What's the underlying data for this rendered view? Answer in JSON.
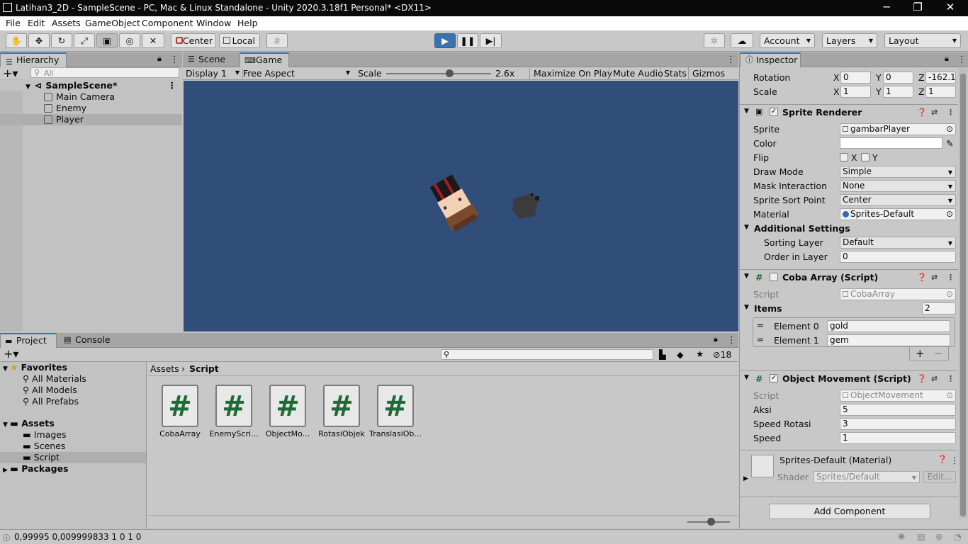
{
  "window": {
    "title": "Latihan3_2D - SampleScene - PC, Mac & Linux Standalone - Unity 2020.3.18f1 Personal* <DX11>",
    "minimize": "─",
    "restore": "❐",
    "close": "✕"
  },
  "menu": [
    "File",
    "Edit",
    "Assets",
    "GameObject",
    "Component",
    "Window",
    "Help"
  ],
  "toolbar": {
    "center": "Center",
    "local": "Local",
    "account": "Account",
    "layers": "Layers",
    "layout": "Layout"
  },
  "hierarchy": {
    "tab": "Hierarchy",
    "search_placeholder": "All",
    "scene": "SampleScene*",
    "items": [
      "Main Camera",
      "Enemy",
      "Player"
    ]
  },
  "game_view": {
    "tabs": [
      "Scene",
      "Game"
    ],
    "display": "Display 1",
    "aspect": "Free Aspect",
    "scale_label": "Scale",
    "scale_value": "2.6x",
    "scale_fraction": 0.6,
    "buttons": [
      "Maximize On Play",
      "Mute Audio",
      "Stats",
      "Gizmos"
    ],
    "bg_color": "#314d79"
  },
  "project": {
    "tabs": [
      "Project",
      "Console"
    ],
    "hidden_count": "18",
    "favorites": "Favorites",
    "favorite_items": [
      "All Materials",
      "All Models",
      "All Prefabs"
    ],
    "assets": "Assets",
    "asset_folders": [
      "Images",
      "Scenes",
      "Script"
    ],
    "packages": "Packages",
    "breadcrumb": [
      "Assets",
      "Script"
    ],
    "files": [
      "CobaArray",
      "EnemyScri...",
      "ObjectMo...",
      "RotasiObjek",
      "TranslasiOb..."
    ]
  },
  "inspector": {
    "tab": "Inspector",
    "rotation": {
      "label": "Rotation",
      "x": "0",
      "y": "0",
      "z": "-162.18"
    },
    "scale": {
      "label": "Scale",
      "x": "1",
      "y": "1",
      "z": "1"
    },
    "sprite_renderer": {
      "title": "Sprite Renderer",
      "sprite_label": "Sprite",
      "sprite": "gambarPlayer",
      "color_label": "Color",
      "flip_label": "Flip",
      "flip_x": "X",
      "flip_y": "Y",
      "draw_mode_label": "Draw Mode",
      "draw_mode": "Simple",
      "mask_label": "Mask Interaction",
      "mask": "None",
      "sort_point_label": "Sprite Sort Point",
      "sort_point": "Center",
      "material_label": "Material",
      "material": "Sprites-Default",
      "additional": "Additional Settings",
      "sorting_layer_label": "Sorting Layer",
      "sorting_layer": "Default",
      "order_label": "Order in Layer",
      "order": "0"
    },
    "coba_array": {
      "title": "Coba Array (Script)",
      "script_label": "Script",
      "script": "CobaArray",
      "items_label": "Items",
      "items_count": "2",
      "elements": [
        {
          "label": "Element 0",
          "value": "gold"
        },
        {
          "label": "Element 1",
          "value": "gem"
        }
      ]
    },
    "object_movement": {
      "title": "Object Movement (Script)",
      "script_label": "Script",
      "script": "ObjectMovement",
      "aksi_label": "Aksi",
      "aksi": "5",
      "speed_rot_label": "Speed Rotasi",
      "speed_rot": "3",
      "speed_label": "Speed",
      "speed": "1"
    },
    "material": {
      "title": "Sprites-Default (Material)",
      "shader_label": "Shader",
      "shader": "Sprites/Default",
      "edit": "Edit..."
    },
    "add_component": "Add Component"
  },
  "status": {
    "text": "0,99995 0,009999833 1 0 1 0"
  }
}
